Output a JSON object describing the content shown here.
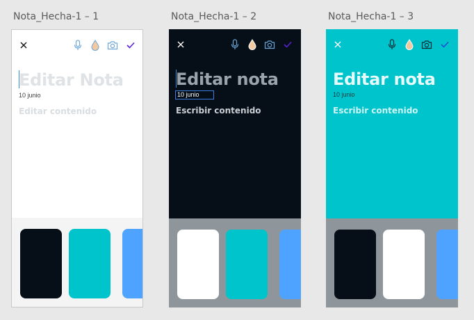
{
  "artboards": [
    {
      "name": "Nota_Hecha-1 – 1",
      "title_placeholder": "Editar Nota",
      "date": "10 junio",
      "content_placeholder": "Editar contenido",
      "background": "#ffffff",
      "swatches": [
        "#060e18",
        "#00c4cc",
        "#4da3ff"
      ]
    },
    {
      "name": "Nota_Hecha-1 – 2",
      "title_placeholder": "Editar nota",
      "date": "10 junio",
      "content_placeholder": "Escribir contenido",
      "background": "#060e18",
      "swatches": [
        "#ffffff",
        "#00c4cc",
        "#4da3ff"
      ]
    },
    {
      "name": "Nota_Hecha-1 – 3",
      "title_placeholder": "Editar nota",
      "date": "10 junio",
      "content_placeholder": "Escribir contenido",
      "background": "#00c4cc",
      "swatches": [
        "#060e18",
        "#ffffff",
        "#4da3ff"
      ]
    }
  ],
  "toolbar_icons": [
    "close-icon",
    "microphone-icon",
    "drop-icon",
    "camera-icon",
    "check-icon"
  ],
  "colors": {
    "accent_check": "#5b21d6",
    "mic_blue": "#6aa6d8",
    "drop_fill": "#f2c9a0"
  }
}
